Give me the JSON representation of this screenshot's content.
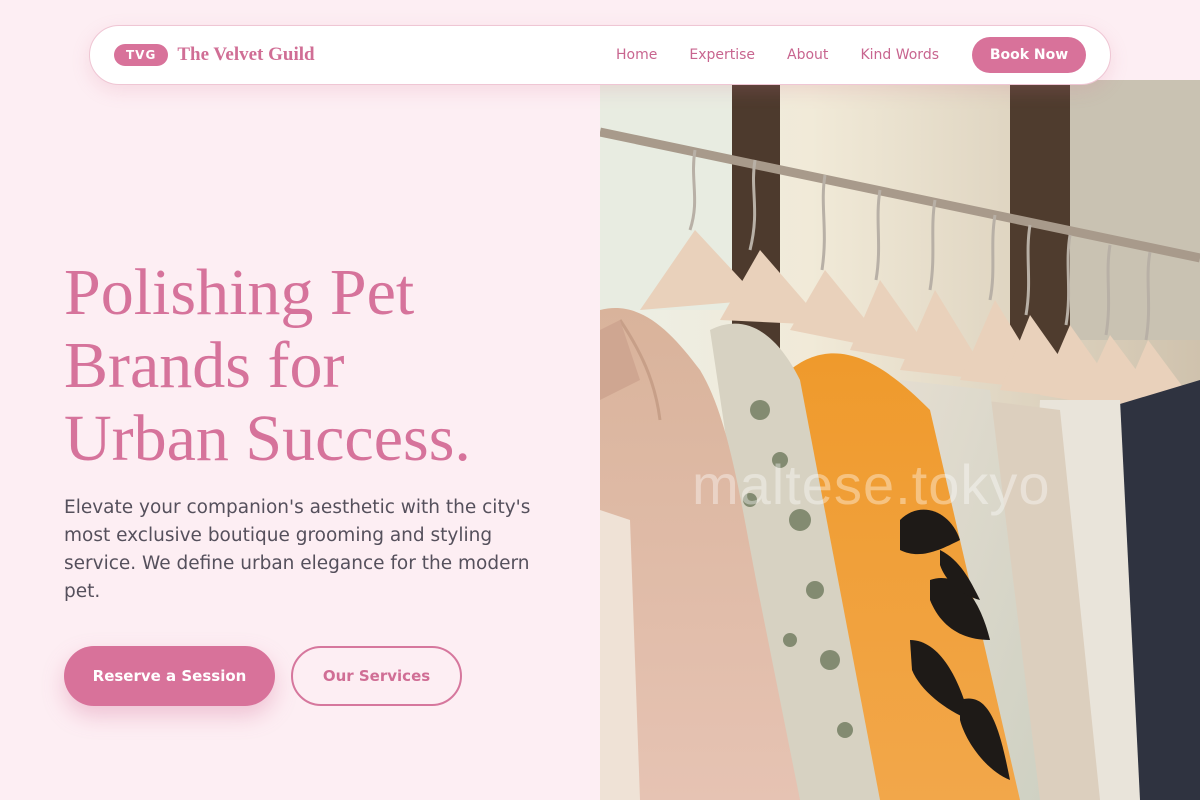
{
  "brand": {
    "badge": "TVG",
    "name": "The Velvet Guild"
  },
  "nav": {
    "links": [
      "Home",
      "Expertise",
      "About",
      "Kind Words"
    ],
    "cta": "Book Now"
  },
  "hero": {
    "title_lines": [
      "Polishing Pet",
      "Brands for",
      "Urban Success."
    ],
    "description": "Elevate your companion's aesthetic with the city's most exclusive boutique grooming and styling service. We define urban elegance for the modern pet.",
    "primary_button": "Reserve a Session",
    "secondary_button": "Our Services"
  },
  "image": {
    "subject": "clothing rack with garments on wooden hangers",
    "watermark": "maltese.tokyo"
  },
  "colors": {
    "accent": "#d8729a",
    "background": "#fdeef3",
    "body_text": "#55505c"
  }
}
